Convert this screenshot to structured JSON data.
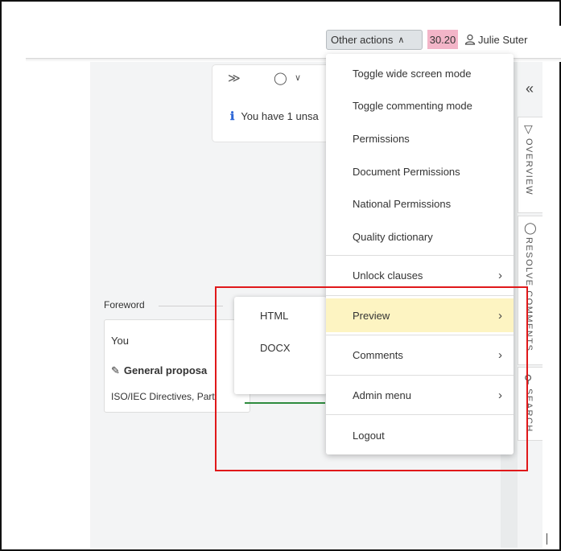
{
  "header": {
    "other_actions_label": "Other actions",
    "timer": "30.20",
    "user_name": "Julie Suter"
  },
  "toolbar": {
    "unsaved_text": "You have 1 unsa"
  },
  "menu": {
    "items": [
      {
        "label": "Toggle wide screen mode"
      },
      {
        "label": "Toggle commenting mode"
      },
      {
        "label": "Permissions"
      },
      {
        "label": "Document Permissions"
      },
      {
        "label": "National Permissions"
      },
      {
        "label": "Quality dictionary"
      },
      {
        "label": "Unlock clauses"
      },
      {
        "label": "Preview"
      },
      {
        "label": "Comments"
      },
      {
        "label": "Admin menu"
      },
      {
        "label": "Logout"
      }
    ]
  },
  "submenu": {
    "items": [
      {
        "label": "HTML"
      },
      {
        "label": "DOCX"
      }
    ]
  },
  "document": {
    "foreword": "Foreword",
    "author": "You",
    "proposal": "General proposa",
    "reference": "ISO/IEC Directives, Part"
  },
  "side_tabs": {
    "overview": "OVERVIEW",
    "resolve_comments": "RESOLVE COMMENTS",
    "search": "SEARCH"
  },
  "colors": {
    "highlight": "#fdf4c2",
    "timer_bg": "#f3b5c8",
    "annotation_red": "#e0181a"
  }
}
